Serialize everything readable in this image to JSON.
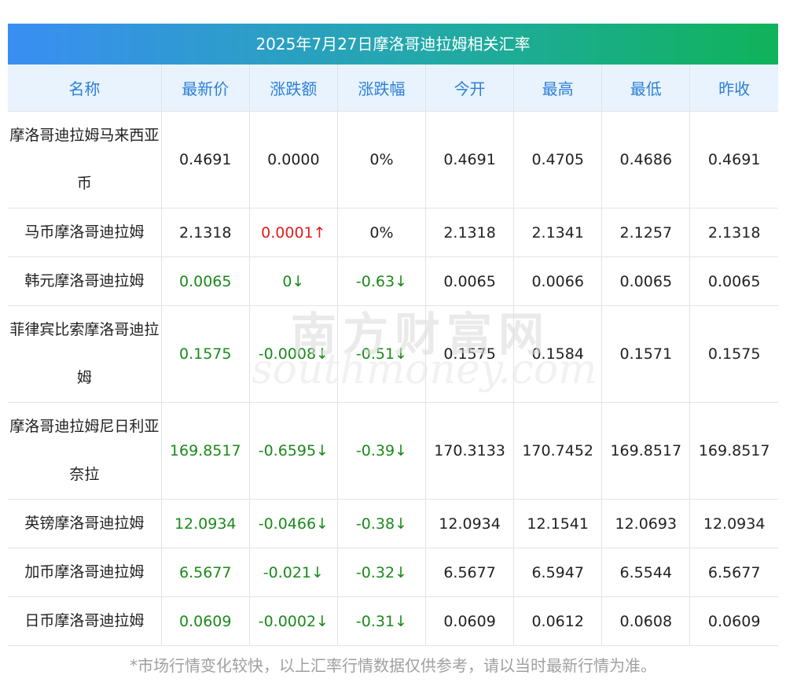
{
  "title": "2025年7月27日摩洛哥迪拉姆相关汇率",
  "columns": [
    "名称",
    "最新价",
    "涨跌额",
    "涨跌幅",
    "今开",
    "最高",
    "最低",
    "昨收"
  ],
  "rows": [
    {
      "name": "摩洛哥迪拉姆马来西亚币",
      "latest": "0.4691",
      "change": "0.0000",
      "pct": "0%",
      "open": "0.4691",
      "high": "0.4705",
      "low": "0.4686",
      "prev": "0.4691",
      "trend": "flat",
      "lines": 2
    },
    {
      "name": "马币摩洛哥迪拉姆",
      "latest": "2.1318",
      "change": "0.0001↑",
      "pct": "0%",
      "open": "2.1318",
      "high": "2.1341",
      "low": "2.1257",
      "prev": "2.1318",
      "trend": "up-change",
      "lines": 1
    },
    {
      "name": "韩元摩洛哥迪拉姆",
      "latest": "0.0065",
      "change": "0↓",
      "pct": "-0.63↓",
      "open": "0.0065",
      "high": "0.0066",
      "low": "0.0065",
      "prev": "0.0065",
      "trend": "down",
      "lines": 1
    },
    {
      "name": "菲律宾比索摩洛哥迪拉姆",
      "latest": "0.1575",
      "change": "-0.0008↓",
      "pct": "-0.51↓",
      "open": "0.1575",
      "high": "0.1584",
      "low": "0.1571",
      "prev": "0.1575",
      "trend": "down",
      "lines": 2
    },
    {
      "name": "摩洛哥迪拉姆尼日利亚奈拉",
      "latest": "169.8517",
      "change": "-0.6595↓",
      "pct": "-0.39↓",
      "open": "170.3133",
      "high": "170.7452",
      "low": "169.8517",
      "prev": "169.8517",
      "trend": "down",
      "lines": 2
    },
    {
      "name": "英镑摩洛哥迪拉姆",
      "latest": "12.0934",
      "change": "-0.0466↓",
      "pct": "-0.38↓",
      "open": "12.0934",
      "high": "12.1541",
      "low": "12.0693",
      "prev": "12.0934",
      "trend": "down",
      "lines": 1
    },
    {
      "name": "加币摩洛哥迪拉姆",
      "latest": "6.5677",
      "change": "-0.021↓",
      "pct": "-0.32↓",
      "open": "6.5677",
      "high": "6.5947",
      "low": "6.5544",
      "prev": "6.5677",
      "trend": "down",
      "lines": 1
    },
    {
      "name": "日币摩洛哥迪拉姆",
      "latest": "0.0609",
      "change": "-0.0002↓",
      "pct": "-0.31↓",
      "open": "0.0609",
      "high": "0.0612",
      "low": "0.0608",
      "prev": "0.0609",
      "trend": "down",
      "lines": 1
    }
  ],
  "watermark": {
    "cn": "南方财富网",
    "en": "southmoney.com"
  },
  "footnote": "*市场行情变化较快，以上汇率行情数据仅供参考，请以当时最新行情为准。",
  "colors": {
    "up": "#e21c1c",
    "down": "#1a8a1a",
    "header_text": "#2d7fd8",
    "header_bg": "#e8f3fd"
  }
}
